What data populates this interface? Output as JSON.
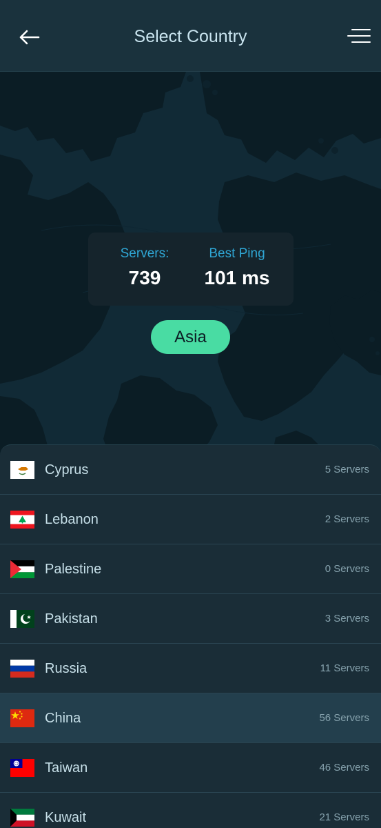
{
  "header": {
    "title": "Select Country"
  },
  "stats": {
    "servers_label": "Servers:",
    "servers_value": "739",
    "ping_label": "Best Ping",
    "ping_value": "101 ms"
  },
  "region": {
    "label": "Asia"
  },
  "colors": {
    "accent_green": "#49dca3",
    "accent_blue": "#2fa6d4",
    "background": "#122833"
  },
  "countries": [
    {
      "name": "Cyprus",
      "servers": "5 Servers",
      "flag": "cyprus-flag-icon",
      "selected": false
    },
    {
      "name": "Lebanon",
      "servers": "2 Servers",
      "flag": "lebanon-flag-icon",
      "selected": false
    },
    {
      "name": "Palestine",
      "servers": "0 Servers",
      "flag": "palestine-flag-icon",
      "selected": false
    },
    {
      "name": "Pakistan",
      "servers": "3 Servers",
      "flag": "pakistan-flag-icon",
      "selected": false
    },
    {
      "name": "Russia",
      "servers": "11 Servers",
      "flag": "russia-flag-icon",
      "selected": false
    },
    {
      "name": "China",
      "servers": "56 Servers",
      "flag": "china-flag-icon",
      "selected": true
    },
    {
      "name": "Taiwan",
      "servers": "46 Servers",
      "flag": "taiwan-flag-icon",
      "selected": false
    },
    {
      "name": "Kuwait",
      "servers": "21 Servers",
      "flag": "kuwait-flag-icon",
      "selected": false
    }
  ]
}
